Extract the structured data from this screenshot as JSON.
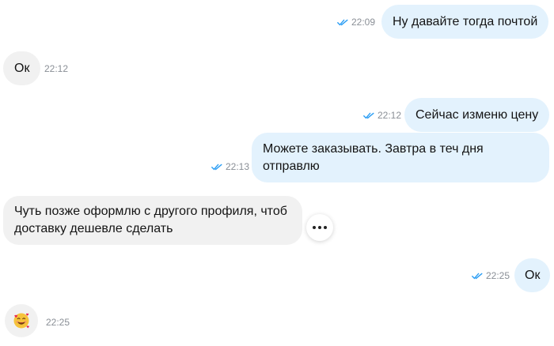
{
  "messages": [
    {
      "id": "m1",
      "direction": "out",
      "text": "Ну давайте тогда почтой",
      "time": "22:09",
      "read": true
    },
    {
      "id": "m2",
      "direction": "in",
      "text": "Ок",
      "time": "22:12"
    },
    {
      "id": "m3",
      "direction": "out",
      "text": "Сейчас изменю цену",
      "time": "22:12",
      "read": true
    },
    {
      "id": "m4",
      "direction": "out",
      "text": "Можете заказывать. Завтра в теч дня отправлю",
      "time": "22:13",
      "read": true
    },
    {
      "id": "m5",
      "direction": "in",
      "text": "Чуть позже оформлю с другого профиля, чтоб доставку дешевле сделать",
      "time": ""
    },
    {
      "id": "m6",
      "direction": "out",
      "text": "Ок",
      "time": "22:25",
      "read": true
    },
    {
      "id": "m7",
      "direction": "in",
      "sticker": "smiling-face-with-hearts-emoji",
      "time": "22:25"
    }
  ],
  "colors": {
    "outgoing_bubble": "#e3f2fd",
    "incoming_bubble": "#f1f1f1",
    "read_ticks": "#2a9df4",
    "timestamp": "#8a8f96"
  },
  "icons": {
    "read_status": "double-check-icon",
    "message_actions": "more-horizontal-icon"
  }
}
